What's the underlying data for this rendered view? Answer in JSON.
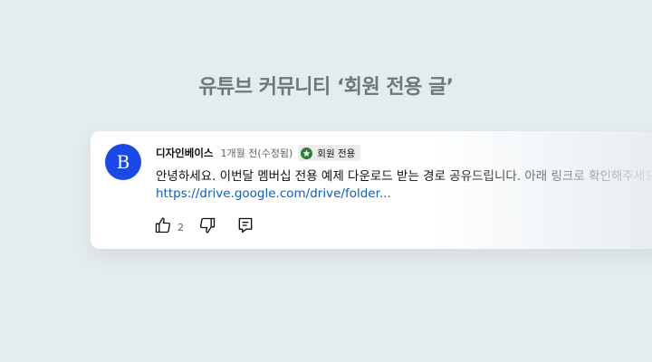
{
  "page": {
    "title": "유튜브 커뮤니티 ‘회원 전용 글’"
  },
  "comment": {
    "author": "디자인베이스",
    "avatar_letter": "B",
    "time": "1개월 전(수정됨)",
    "badge": {
      "label": "회원 전용",
      "icon": "star-icon"
    },
    "text": "안녕하세요. 이번달 멤버십 전용 예제 다운로드 받는 경로 공유드립니다. 아래 링크로 확인해주세요.",
    "link": "https://drive.google.com/drive/folder...",
    "likes": "2",
    "actions": {
      "like_icon": "thumbs-up-icon",
      "dislike_icon": "thumbs-down-icon",
      "reply_icon": "reply-icon"
    }
  },
  "colors": {
    "background": "#e5ecf0",
    "avatar": "#1b49e8",
    "link": "#065fd4",
    "badge_icon": "#2e7d32",
    "title": "#6f767c"
  }
}
